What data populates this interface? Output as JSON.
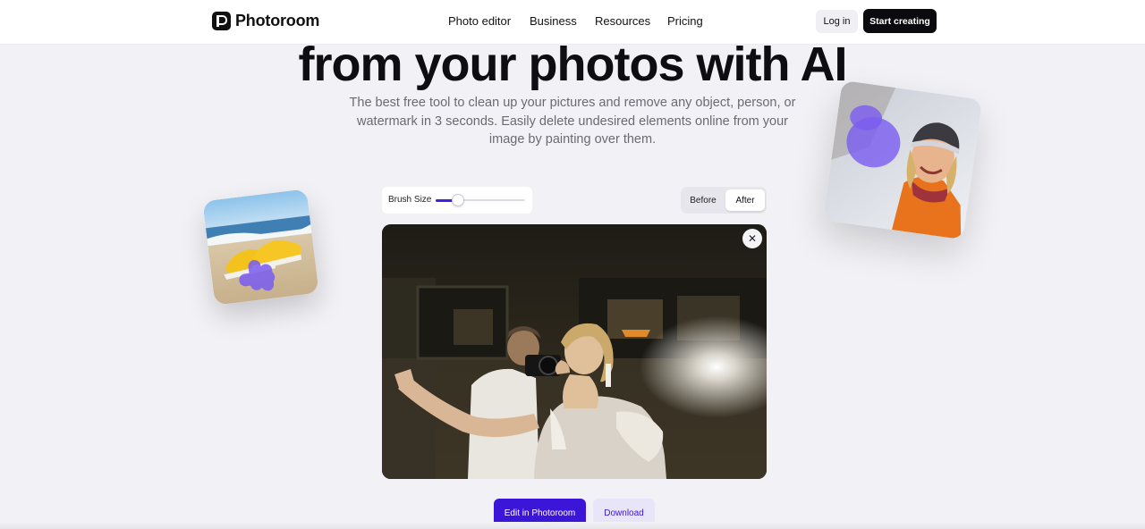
{
  "brand": {
    "name": "Photoroom"
  },
  "nav": {
    "links": [
      "Photo editor",
      "Business",
      "Resources",
      "Pricing"
    ],
    "login_label": "Log in",
    "cta_label": "Start creating"
  },
  "hero": {
    "title": "from your photos with AI",
    "subtitle": "The best free tool to clean up your pictures and remove any object, person, or watermark in 3 seconds. Easily delete undesired elements online from your image by painting over them."
  },
  "editor": {
    "brush_label": "Brush Size",
    "brush_level": 0.25,
    "toggle": {
      "before": "Before",
      "after": "After",
      "selected": "After"
    },
    "close_glyph": "✕"
  },
  "actions": {
    "edit_label": "Edit in Photoroom",
    "download_label": "Download"
  },
  "colors": {
    "accent": "#3c16d8",
    "brush_mark": "#7a5cf0",
    "primary_dark": "#0b0b0f"
  },
  "icons": [
    "photoroom-logo-icon",
    "close-icon"
  ]
}
